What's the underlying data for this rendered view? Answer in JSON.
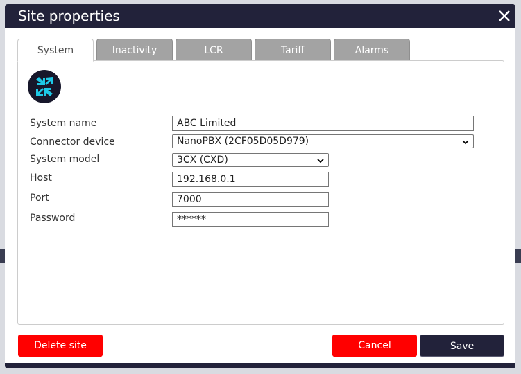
{
  "dialog": {
    "title": "Site properties",
    "close_icon": "close-icon"
  },
  "tabs": [
    {
      "label": "System",
      "active": true
    },
    {
      "label": "Inactivity",
      "active": false
    },
    {
      "label": "LCR",
      "active": false
    },
    {
      "label": "Tariff",
      "active": false
    },
    {
      "label": "Alarms",
      "active": false
    }
  ],
  "logo_icon": "arrows-in-out-icon",
  "form": {
    "system_name": {
      "label": "System name",
      "value": "ABC Limited"
    },
    "connector_device": {
      "label": "Connector device",
      "value": "NanoPBX (2CF05D05D979)"
    },
    "system_model": {
      "label": "System model",
      "value": "3CX (CXD)"
    },
    "host": {
      "label": "Host",
      "value": "192.168.0.1"
    },
    "port": {
      "label": "Port",
      "value": "7000"
    },
    "password": {
      "label": "Password",
      "value": "******"
    }
  },
  "buttons": {
    "delete": "Delete site",
    "cancel": "Cancel",
    "save": "Save"
  },
  "colors": {
    "dialog_dark": "#22223a",
    "danger": "#ff0000",
    "tab_inactive": "#a3a3a3",
    "logo_accent": "#1ec8e6"
  }
}
